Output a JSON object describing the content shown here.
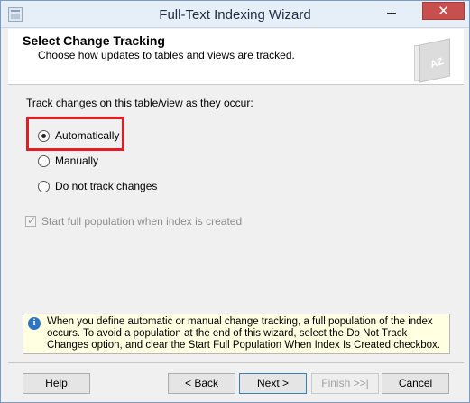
{
  "window": {
    "title": "Full-Text Indexing Wizard",
    "close_glyph": "✕"
  },
  "header": {
    "title": "Select Change Tracking",
    "subtitle": "Choose how updates to tables and views are tracked.",
    "logo_text": "AZ"
  },
  "tracking": {
    "prompt": "Track changes on this table/view as they occur:",
    "options": [
      {
        "label": "Automatically",
        "selected": true
      },
      {
        "label": "Manually",
        "selected": false
      },
      {
        "label": "Do not track changes",
        "selected": false
      }
    ]
  },
  "population": {
    "label": "Start full population when index is created",
    "checked": true,
    "disabled": true
  },
  "info": {
    "icon": "info-icon",
    "text": "When you define automatic or manual change tracking, a full population of the index occurs. To avoid a population at the end of this wizard, select the Do Not Track Changes option, and clear the Start Full Population When Index Is Created checkbox."
  },
  "buttons": {
    "help": "Help",
    "back": "< Back",
    "next": "Next >",
    "finish": "Finish >>|",
    "cancel": "Cancel"
  },
  "colors": {
    "highlight": "#e31c23",
    "info_bg": "#ffffe1",
    "close_btn": "#c7504f"
  }
}
